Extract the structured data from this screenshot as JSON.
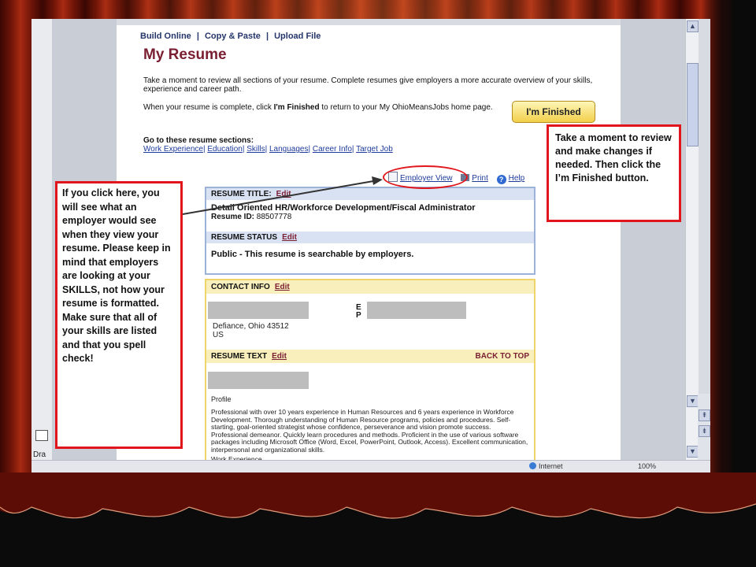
{
  "nav": {
    "build_online": "Build Online",
    "copy_paste": "Copy & Paste",
    "upload_file": "Upload File",
    "separator": "|"
  },
  "page_title": "My Resume",
  "intro_text": "Take a moment to review all sections of your resume. Complete resumes give employers a more accurate overview of your skills, experience and career path.",
  "complete_text_before": "When your resume is complete, click ",
  "complete_text_emph": "I'm Finished",
  "complete_text_after": " to return to your My OhioMeansJobs home page.",
  "finished_button": "I'm Finished",
  "sections": {
    "label": "Go to these resume sections:",
    "links": [
      "Work Experience",
      "Education",
      "Skills",
      "Languages",
      "Career Info",
      "Target Job"
    ]
  },
  "top_links": {
    "employer_view": "Employer View",
    "print": "Print",
    "help": "Help"
  },
  "resume_title": {
    "header": "RESUME TITLE:",
    "edit": "Edit",
    "value": "Detail Oriented HR/Workforce Development/Fiscal Administrator",
    "id_label": "Resume ID:",
    "id_value": "88507778"
  },
  "resume_status": {
    "header": "RESUME STATUS",
    "edit": "Edit",
    "value": "Public - This resume is searchable by employers."
  },
  "contact_info": {
    "header": "CONTACT INFO",
    "edit": "Edit",
    "email_label": "E",
    "phone_label": "P",
    "city": "Defiance, Ohio 43512",
    "country": "US"
  },
  "resume_text": {
    "header": "RESUME TEXT",
    "edit": "Edit",
    "back_to_top": "BACK TO TOP",
    "profile_label": "Profile",
    "profile_text": "Professional with over 10 years experience in Human Resources and 6 years experience in Workforce Development. Thorough understanding of Human Resource programs, policies and procedures. Self-starting, goal-oriented strategist whose confidence, perseverance and vision promote success. Professional demeanor. Quickly learn procedures and methods. Proficient in the use of various software packages including Microsoft Office (Word, Excel, PowerPoint, Outlook, Access). Excellent communication, interpersonal and organizational skills.",
    "work_experience": "Work Experience"
  },
  "statusbar": {
    "zone": "Internet",
    "zoom": "100%"
  },
  "left_frame": {
    "tab_label": "Dra"
  },
  "callouts": {
    "left": "If you click here, you will see what an employer would see when they view your resume. Please keep in mind that employers are looking at your SKILLS, not how your resume is formatted.  Make sure that all of your skills are listed and that you spell check!",
    "right": "Take a moment to review and make changes if needed.  Then click the I’m Finished button."
  },
  "colors": {
    "annotation_red": "#e1161c",
    "title_maroon": "#7a1e32",
    "link_blue": "#1d3a9a",
    "button_yellow": "#f2d04a"
  }
}
